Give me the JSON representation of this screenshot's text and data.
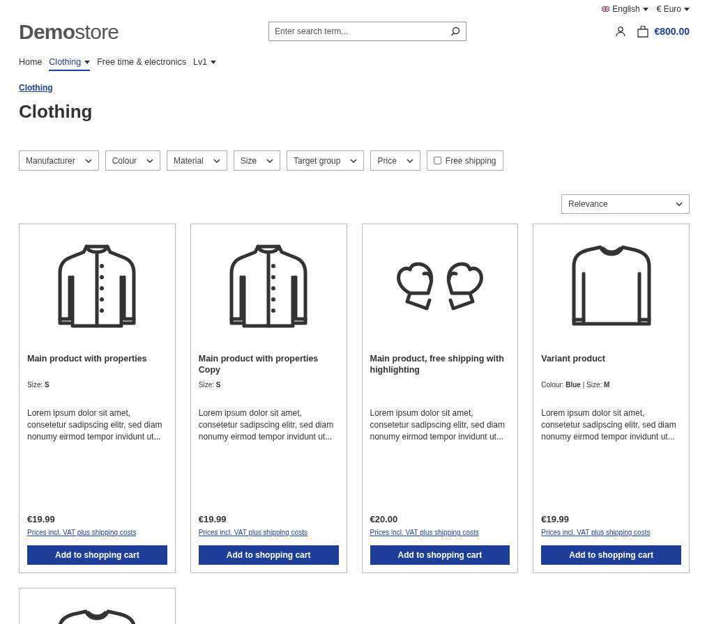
{
  "top_bar": {
    "language": "English",
    "currency": "€ Euro"
  },
  "header": {
    "logo_bold": "Demo",
    "logo_light": "store",
    "search": {
      "placeholder": "Enter search term..."
    },
    "cart_total": "€800.00"
  },
  "nav": [
    {
      "label": "Home",
      "selected": false,
      "dropdown": false
    },
    {
      "label": "Clothing",
      "selected": true,
      "dropdown": true
    },
    {
      "label": "Free time & electronics",
      "selected": false,
      "dropdown": false
    },
    {
      "label": "Lv1",
      "selected": false,
      "dropdown": true
    }
  ],
  "breadcrumb": "Clothing",
  "title": "Clothing",
  "filters": [
    {
      "kind": "dropdown",
      "label": "Manufacturer"
    },
    {
      "kind": "dropdown",
      "label": "Colour"
    },
    {
      "kind": "dropdown",
      "label": "Material"
    },
    {
      "kind": "dropdown",
      "label": "Size"
    },
    {
      "kind": "dropdown",
      "label": "Target group"
    },
    {
      "kind": "dropdown",
      "label": "Price"
    },
    {
      "kind": "checkbox",
      "label": "Free shipping",
      "checked": false
    }
  ],
  "sort": "Relevance",
  "products": [
    {
      "kind": "jacket",
      "name": "Main product with properties",
      "properties": "Size: **S**",
      "description": "Lorem ipsum dolor sit amet, consetetur sadipscing elitr, sed diam nonumy eirmod tempor invidunt ut...",
      "price": "€19.99",
      "price_note": "Prices incl. VAT plus shipping costs",
      "button": "Add to shopping cart"
    },
    {
      "kind": "jacket",
      "name": "Main product with properties Copy",
      "properties": "Size: **S**",
      "description": "Lorem ipsum dolor sit amet, consetetur sadipscing elitr, sed diam nonumy eirmod tempor invidunt ut...",
      "price": "€19.99",
      "price_note": "Prices incl. VAT plus shipping costs",
      "button": "Add to shopping cart"
    },
    {
      "kind": "mittens",
      "name": "Main product, free shipping with highlighting",
      "description": "Lorem ipsum dolor sit amet, consetetur sadipscing elitr, sed diam nonumy eirmod tempor invidunt ut...",
      "price": "€20.00",
      "price_note": "Prices incl. VAT plus shipping costs",
      "button": "Add to shopping cart"
    },
    {
      "kind": "sweater",
      "name": "Variant product",
      "properties": "Colour: **Blue** | Size: **M**",
      "description": "Lorem ipsum dolor sit amet, consetetur sadipscing elitr, sed diam nonumy eirmod tempor invidunt ut...",
      "price": "€19.99",
      "price_note": "Prices incl. VAT plus shipping costs",
      "button": "Add to shopping cart"
    },
    {
      "kind": "sweater"
    }
  ]
}
